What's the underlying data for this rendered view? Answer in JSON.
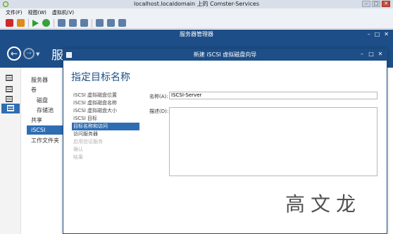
{
  "vm_window": {
    "title": "localhost.localdomain 上的 Comster-Services",
    "menu": [
      "文件(F)",
      "视图(W)",
      "虚拟机(V)"
    ],
    "toolbar_icons": [
      "stop-icon",
      "pause-icon",
      "start-icon",
      "reset-icon",
      "checkpoint-icon",
      "revert-icon",
      "snapshot-icon",
      "insert-disk-icon",
      "share-icon",
      "settings-icon"
    ]
  },
  "server_manager": {
    "title": "服务器管理器",
    "heading_partial": "服",
    "icon_rail": [
      "dashboard-icon",
      "local-server-icon",
      "all-servers-icon",
      "file-storage-icon"
    ],
    "nav": {
      "items": [
        "服务器",
        "卷",
        "磁盘",
        "存储池",
        "共享",
        "iSCSI",
        "工作文件夹"
      ],
      "selected": "iSCSI"
    }
  },
  "wizard": {
    "title": "新建 iSCSI 虚拟磁盘向导",
    "heading": "指定目标名称",
    "steps": [
      {
        "label": "iSCSI 虚拟磁盘位置",
        "state": "done"
      },
      {
        "label": "iSCSI 虚拟磁盘名称",
        "state": "done"
      },
      {
        "label": "iSCSI 虚拟磁盘大小",
        "state": "done"
      },
      {
        "label": "iSCSI 目标",
        "state": "done"
      },
      {
        "label": "目标名称和访问",
        "state": "current"
      },
      {
        "label": "访问服务器",
        "state": "pending"
      },
      {
        "label": "启用验证服务",
        "state": "disabled"
      },
      {
        "label": "确认",
        "state": "disabled"
      },
      {
        "label": "结果",
        "state": "disabled"
      }
    ],
    "name_label": "名称(A):",
    "name_value": "ISCSI-Server",
    "desc_label": "描述(D):",
    "desc_value": ""
  },
  "watermark": "高文龙",
  "colors": {
    "accent": "#1d4e87",
    "selection": "#2f6db3"
  }
}
